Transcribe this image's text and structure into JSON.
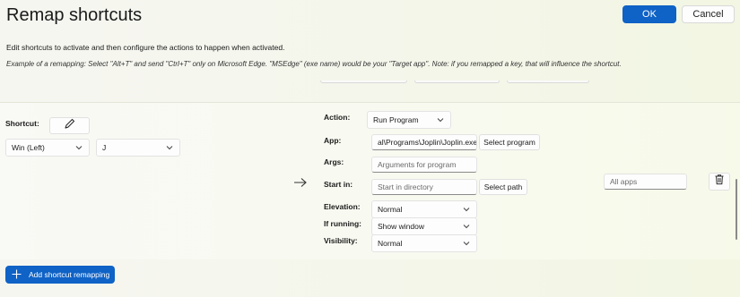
{
  "header": {
    "title": "Remap shortcuts",
    "ok_label": "OK",
    "cancel_label": "Cancel"
  },
  "description": {
    "line1": "Edit shortcuts to activate and then configure the actions to happen when activated.",
    "line2": "Example of a remapping: Select \"Alt+T\" and send \"Ctrl+T\" only on Microsoft Edge. \"MSEdge\" (exe name) would be your \"Target app\". Note: if you remapped a key, that will influence the shortcut."
  },
  "shortcut": {
    "label": "Shortcut:",
    "edit_icon": "pencil-icon",
    "modifier_value": "Win (Left)",
    "key_value": "J"
  },
  "action": {
    "action_label": "Action:",
    "action_value": "Run Program",
    "app_label": "App:",
    "app_value": "al\\Programs\\Joplin\\Joplin.exe",
    "select_program_label": "Select program",
    "args_label": "Args:",
    "args_placeholder": "Arguments for program",
    "start_in_label": "Start in:",
    "start_in_placeholder": "Start in directory",
    "select_path_label": "Select path",
    "elevation_label": "Elevation:",
    "elevation_value": "Normal",
    "if_running_label": "If running:",
    "if_running_value": "Show window",
    "visibility_label": "Visibility:",
    "visibility_value": "Normal"
  },
  "target_app": {
    "placeholder": "All apps"
  },
  "footer": {
    "add_label": "Add shortcut remapping"
  },
  "colors": {
    "accent": "#0f62c6"
  }
}
